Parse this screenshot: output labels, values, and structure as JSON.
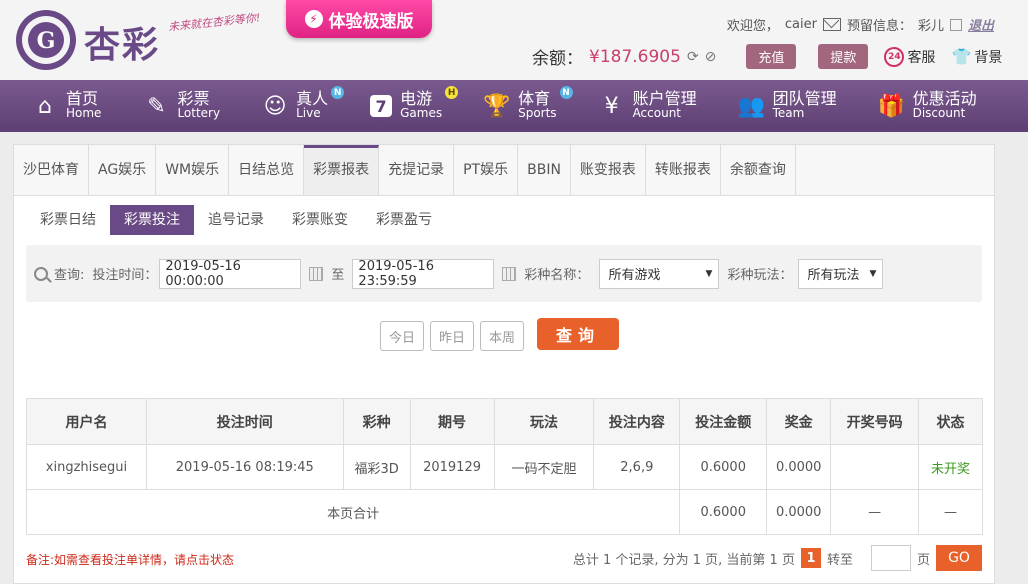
{
  "header": {
    "brand": "杏彩",
    "slogan": "未来就在杏彩等你!",
    "promo_label": "体验极速版",
    "welcome": "欢迎您，",
    "username": "caier",
    "notice_label": "预留信息：",
    "notice_value": "彩儿",
    "logout": "退出",
    "balance_label": "余额：",
    "balance_value": "¥187.6905",
    "deposit": "充值",
    "withdraw": "提款",
    "service": "客服",
    "background": "背景"
  },
  "nav": [
    {
      "zh": "首页",
      "en": "Home",
      "icon": "home-icon",
      "badge": ""
    },
    {
      "zh": "彩票",
      "en": "Lottery",
      "icon": "ticket-icon",
      "badge": ""
    },
    {
      "zh": "真人",
      "en": "Live",
      "icon": "person-icon",
      "badge": "N"
    },
    {
      "zh": "电游",
      "en": "Games",
      "icon": "seven-icon",
      "badge": "H"
    },
    {
      "zh": "体育",
      "en": "Sports",
      "icon": "trophy-icon",
      "badge": "N"
    },
    {
      "zh": "账户管理",
      "en": "Account",
      "icon": "yen-icon",
      "badge": ""
    },
    {
      "zh": "团队管理",
      "en": "Team",
      "icon": "team-icon",
      "badge": ""
    },
    {
      "zh": "优惠活动",
      "en": "Discount",
      "icon": "gift-icon",
      "badge": ""
    }
  ],
  "tabs": [
    "沙巴体育",
    "AG娱乐",
    "WM娱乐",
    "日结总览",
    "彩票报表",
    "充提记录",
    "PT娱乐",
    "BBIN",
    "账变报表",
    "转账报表",
    "余额查询"
  ],
  "active_tab": "彩票报表",
  "subtabs": [
    "彩票日结",
    "彩票投注",
    "追号记录",
    "彩票账变",
    "彩票盈亏"
  ],
  "active_subtab": "彩票投注",
  "search": {
    "label": "查询:",
    "time_label": "投注时间：",
    "start": "2019-05-16 00:00:00",
    "to": "至",
    "end": "2019-05-16 23:59:59",
    "game_label": "彩种名称：",
    "game_value": "所有游戏",
    "play_label": "彩种玩法：",
    "play_value": "所有玩法"
  },
  "quick": [
    "今日",
    "昨日",
    "本周"
  ],
  "query_btn": "查询",
  "table": {
    "headers": [
      "用户名",
      "投注时间",
      "彩种",
      "期号",
      "玩法",
      "投注内容",
      "投注金额",
      "奖金",
      "开奖号码",
      "状态"
    ],
    "rows": [
      [
        "xingzhisegui",
        "2019-05-16 08:19:45",
        "福彩3D",
        "2019129",
        "一码不定胆",
        "2,6,9",
        "0.6000",
        "0.0000",
        "",
        "未开奖"
      ]
    ],
    "summary": {
      "label": "本页合计",
      "amount": "0.6000",
      "bonus": "0.0000",
      "draw": "—",
      "status": "—"
    }
  },
  "footer_note": "备注:如需查看投注单详情，请点击状态",
  "pager": {
    "summary": "总计 1 个记录, 分为 1 页, 当前第 1 页",
    "current": "1",
    "jump_label": "转至",
    "page_unit": "页",
    "go": "GO"
  }
}
